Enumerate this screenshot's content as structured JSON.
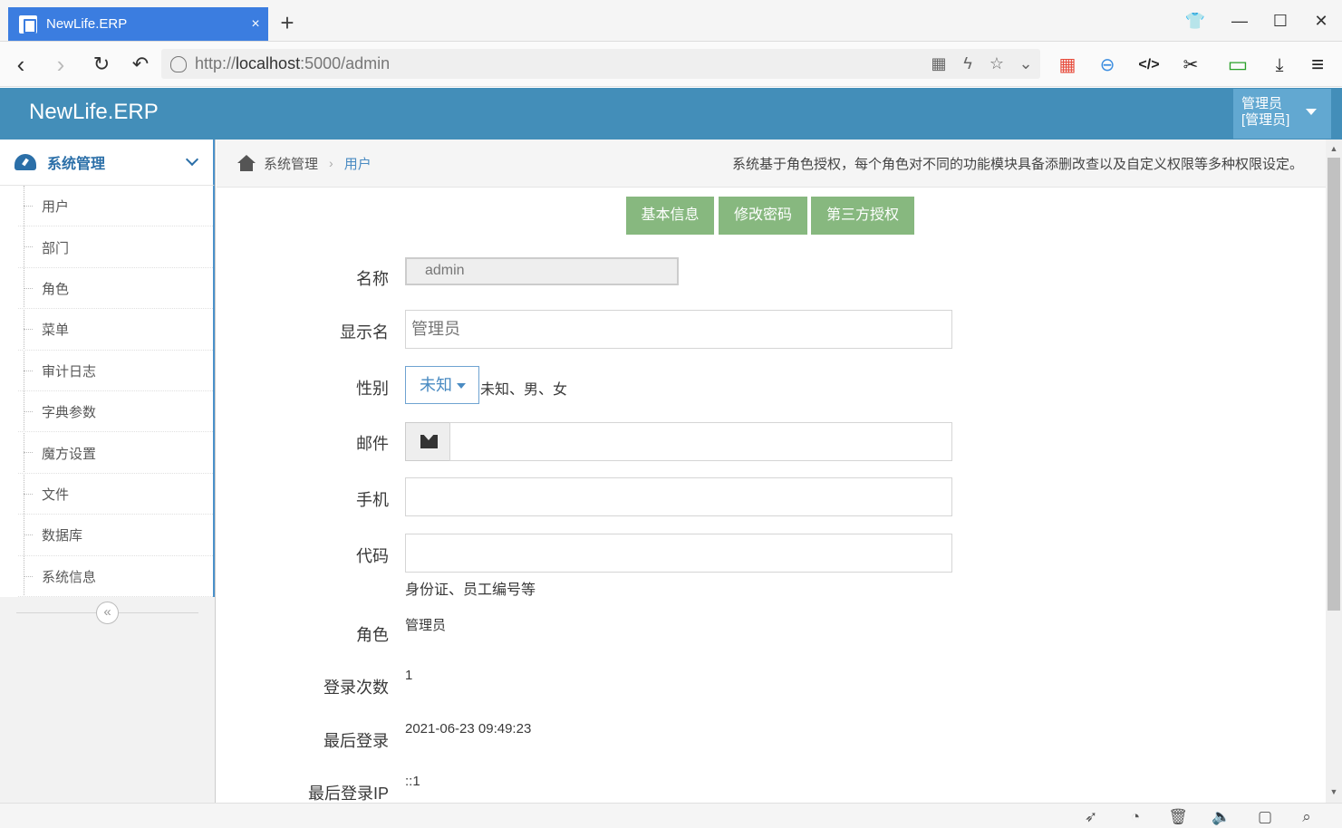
{
  "browser": {
    "tab_title": "NewLife.ERP",
    "tab_close": "×",
    "new_tab": "+",
    "url_scheme": "http://",
    "url_host": "localhost",
    "url_path": ":5000/admin",
    "window_controls": {
      "shirt": "👕",
      "minimize": "—",
      "maximize": "☐",
      "close": "✕"
    },
    "nav": {
      "back": "‹",
      "forward": "›",
      "reload": "↻",
      "undo": "↶"
    },
    "url_icons": {
      "qr": "▦",
      "lightning": "ϟ",
      "star": "☆",
      "dropdown": "⌄"
    },
    "tools": {
      "apps": "▦",
      "minus": "⊖",
      "code": "</>",
      "scissors": "✂",
      "battery": "▭",
      "download": "⤓",
      "menu": "≡"
    }
  },
  "app": {
    "brand": "NewLife.ERP",
    "user_line1": "管理员",
    "user_line2": "[管理员]"
  },
  "sidebar": {
    "section_label": "系统管理",
    "items": [
      {
        "label": "用户"
      },
      {
        "label": "部门"
      },
      {
        "label": "角色"
      },
      {
        "label": "菜单"
      },
      {
        "label": "审计日志"
      },
      {
        "label": "字典参数"
      },
      {
        "label": "魔方设置"
      },
      {
        "label": "文件"
      },
      {
        "label": "数据库"
      },
      {
        "label": "系统信息"
      }
    ],
    "collapse_icon": "«"
  },
  "breadcrumb": {
    "parent": "系统管理",
    "separator": "›",
    "current": "用户",
    "description": "系统基于角色授权，每个角色对不同的功能模块具备添删改查以及自定义权限等多种权限设定。"
  },
  "tabs": {
    "basic": "基本信息",
    "password": "修改密码",
    "oauth": "第三方授权"
  },
  "form": {
    "name_label": "名称",
    "name_value": "admin",
    "display_label": "显示名",
    "display_placeholder": "管理员",
    "gender_label": "性别",
    "gender_value": "未知",
    "gender_hint": "未知、男、女",
    "email_label": "邮件",
    "email_value": "",
    "phone_label": "手机",
    "phone_value": "",
    "code_label": "代码",
    "code_value": "",
    "code_hint": "身份证、员工编号等",
    "role_label": "角色",
    "role_value": "管理员",
    "logins_label": "登录次数",
    "logins_value": "1",
    "last_login_label": "最后登录",
    "last_login_value": "2021-06-23 09:49:23",
    "last_ip_label": "最后登录IP",
    "last_ip_value": "::1"
  },
  "colors": {
    "header": "#438eb9",
    "tab_button": "#87b87f",
    "accent": "#4a8bc2"
  }
}
